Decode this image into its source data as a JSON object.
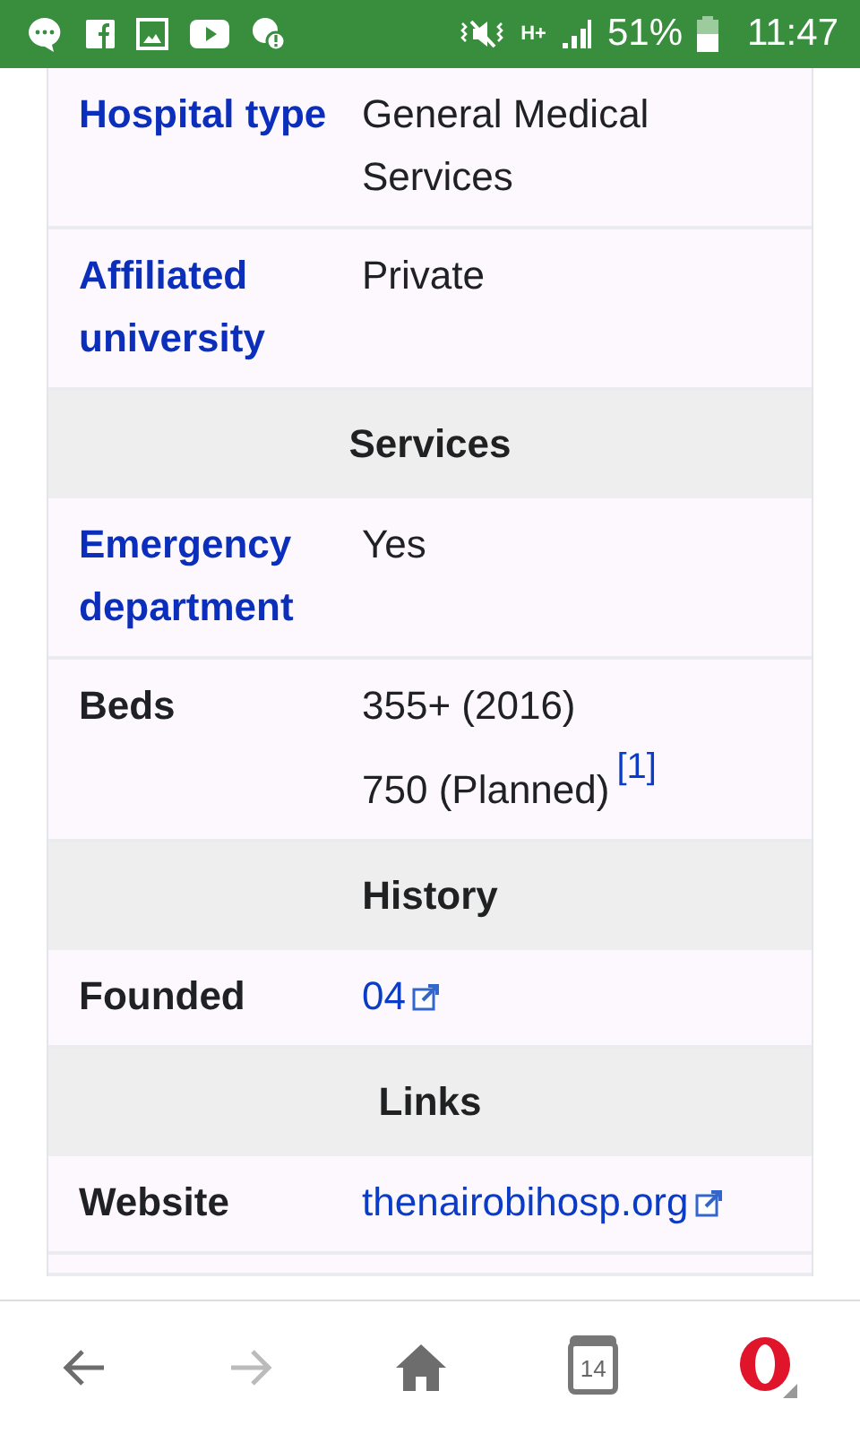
{
  "status_bar": {
    "network": "H+",
    "battery": "51%",
    "time": "11:47"
  },
  "infobox": [
    {
      "kind": "row",
      "label": "Hospital type",
      "label_link": true,
      "lines": [
        {
          "text": "General Medical Services",
          "link": false,
          "external": false
        }
      ]
    },
    {
      "kind": "row",
      "label": "Affiliated university",
      "label_link": true,
      "lines": [
        {
          "text": "Private",
          "link": false,
          "external": false
        }
      ]
    },
    {
      "kind": "header",
      "label": "Services"
    },
    {
      "kind": "row",
      "label": "Emergency department",
      "label_link": true,
      "lines": [
        {
          "text": "Yes",
          "link": false,
          "external": false
        }
      ]
    },
    {
      "kind": "row",
      "label": "Beds",
      "label_link": false,
      "lines": [
        {
          "text": "355+ (2016)",
          "link": false,
          "external": false
        },
        {
          "text": "750 (Planned)",
          "link": false,
          "external": false,
          "ref": "[1]"
        }
      ]
    },
    {
      "kind": "header",
      "label": "History"
    },
    {
      "kind": "row",
      "label": "Founded",
      "label_link": false,
      "lines": [
        {
          "text": "04",
          "link": true,
          "external": true
        }
      ]
    },
    {
      "kind": "header",
      "label": "Links"
    },
    {
      "kind": "row",
      "label": "Website",
      "label_link": false,
      "lines": [
        {
          "text": "thenairobihosp.org",
          "link": true,
          "external": true
        }
      ]
    }
  ],
  "nav_bar": {
    "back_disabled": false,
    "forward_disabled": true,
    "tab_count": "14"
  }
}
